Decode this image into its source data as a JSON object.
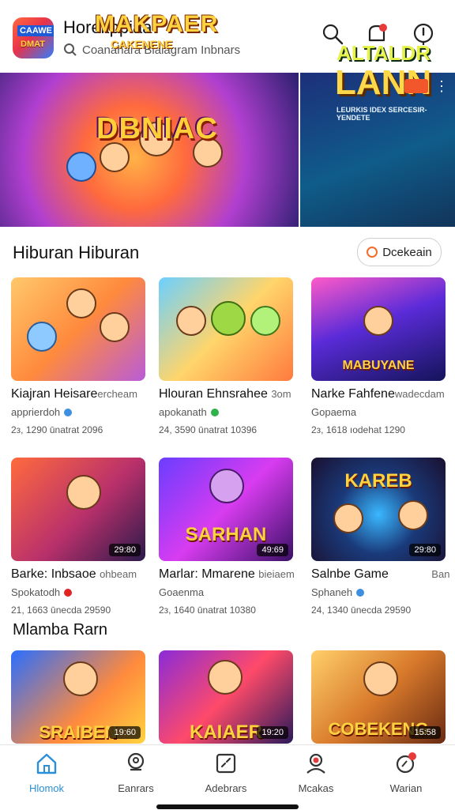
{
  "header": {
    "app_title": "Horekppiaa",
    "search_text": "Coanahara Blalagram Inbnars",
    "logo_line1": "CAAWE",
    "logo_line2": "DMAT"
  },
  "banners": [
    {
      "title": "MAKPAER",
      "subtitle": "CAKENENE",
      "bottom": "DBNIAC"
    },
    {
      "title1": "ALTALDR",
      "title2": "LANN",
      "sub": "LEURKIS IDEX SERCESIR-YENDETE"
    }
  ],
  "section1": {
    "title": "Hiburan Hiburan",
    "filter_label": "Dcekeain"
  },
  "cards_row1": [
    {
      "title": "Kiajran Heisare",
      "title_tail": "ercheam",
      "author": "apprierdoh",
      "verified_color": "#3d8fe0",
      "stats": "2з, 1290 ūnatrat 2096",
      "duration": "",
      "art": ""
    },
    {
      "title": "Hlouran Ehnsrahee",
      "title_tail": "3om",
      "author": "apokanath",
      "verified_color": "#2fb24a",
      "stats": "24, 3590 ūnatrat 10396",
      "duration": "",
      "art": ""
    },
    {
      "title": "Narke Fahfene",
      "title_tail": "wadecdam",
      "author": "Gopaema",
      "verified_color": "",
      "stats": "2з, 1618 ıodehat 1290",
      "duration": "",
      "art": "MABUYANE"
    }
  ],
  "cards_row2": [
    {
      "title": "Barke: Inbsaoe",
      "title_tail": "ohbeam",
      "author": "Spokatodh",
      "verified_color": "#e02424",
      "stats": "21, 1663 ūnecda 29590",
      "duration": "29:80",
      "art": ""
    },
    {
      "title": "Marlar: Mmarene",
      "title_tail": "bieiaem",
      "author": "Goaenma",
      "verified_color": "",
      "stats": "2з, 1640 ūnatrat 10380",
      "duration": "49:69",
      "art": "SARHAN"
    },
    {
      "title": "Salnbe Game",
      "title_tail": "Ban",
      "author": "Sphaneh",
      "verified_color": "#3d8fe0",
      "stats": "24, 1340 ūnecda 29590",
      "duration": "29:80",
      "art": "KAREB"
    }
  ],
  "section2": {
    "title": "Mlamba Rarn"
  },
  "cards_row3": [
    {
      "art": "SRAIBEN",
      "duration": "19:60"
    },
    {
      "art": "KAIAER",
      "duration": "19:20"
    },
    {
      "art": "COBEKENG",
      "duration": "15:58"
    }
  ],
  "bottom_nav": [
    {
      "label": "Hlomok",
      "icon": "home-icon",
      "active": true
    },
    {
      "label": "Eanrars",
      "icon": "explore-icon",
      "active": false
    },
    {
      "label": "Adebrars",
      "icon": "library-icon",
      "active": false
    },
    {
      "label": "Mcakas",
      "icon": "profile-icon",
      "active": false
    },
    {
      "label": "Warian",
      "icon": "activity-icon",
      "active": false
    }
  ],
  "colors": {
    "accent": "#2b8fd8",
    "notification": "#e83a3a",
    "filter_accent": "#f26b2b"
  }
}
